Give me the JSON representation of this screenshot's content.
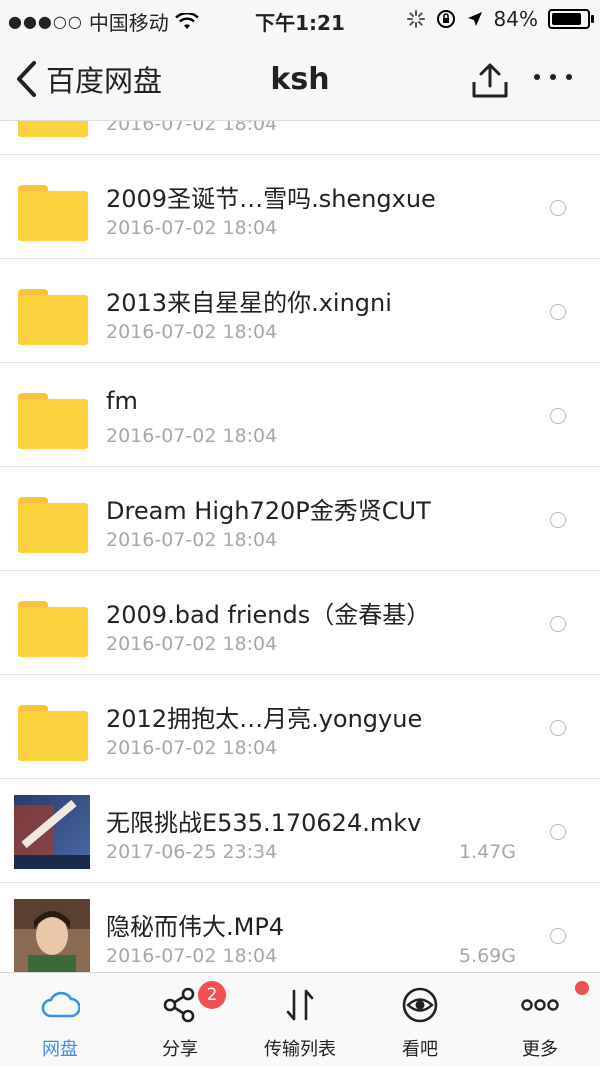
{
  "status_bar": {
    "carrier": "中国移动",
    "time": "下午1:21",
    "battery_percent": "84%",
    "battery_level": 0.84
  },
  "nav": {
    "back_label": "百度网盘",
    "title": "ksh",
    "upload_icon": "upload-icon",
    "more_icon": "more-dots-icon"
  },
  "files": [
    {
      "name": "",
      "date": "2016-07-02 18:04",
      "size": "",
      "type": "folder"
    },
    {
      "name": "2009圣诞节…雪吗.shengxue",
      "date": "2016-07-02 18:04",
      "size": "",
      "type": "folder"
    },
    {
      "name": "2013来自星星的你.xingni",
      "date": "2016-07-02 18:04",
      "size": "",
      "type": "folder"
    },
    {
      "name": "fm",
      "date": "2016-07-02 18:04",
      "size": "",
      "type": "folder"
    },
    {
      "name": "Dream High720P金秀贤CUT",
      "date": "2016-07-02 18:04",
      "size": "",
      "type": "folder"
    },
    {
      "name": "2009.bad friends（金春基）",
      "date": "2016-07-02 18:04",
      "size": "",
      "type": "folder"
    },
    {
      "name": "2012拥抱太…月亮.yongyue",
      "date": "2016-07-02 18:04",
      "size": "",
      "type": "folder"
    },
    {
      "name": "无限挑战E535.170624.mkv",
      "date": "2017-06-25 23:34",
      "size": "1.47G",
      "type": "video"
    },
    {
      "name": "隐秘而伟大.MP4",
      "date": "2016-07-02 18:04",
      "size": "5.69G",
      "type": "video"
    }
  ],
  "tabs": [
    {
      "label": "网盘",
      "icon": "cloud-icon",
      "active": true
    },
    {
      "label": "分享",
      "icon": "share-icon",
      "badge": "2"
    },
    {
      "label": "传输列表",
      "icon": "transfer-icon"
    },
    {
      "label": "看吧",
      "icon": "eye-icon"
    },
    {
      "label": "更多",
      "icon": "more-icon",
      "dot": true
    }
  ],
  "colors": {
    "accent": "#3a8ef6",
    "folder": "#fdd23f",
    "badge": "#f05050"
  }
}
